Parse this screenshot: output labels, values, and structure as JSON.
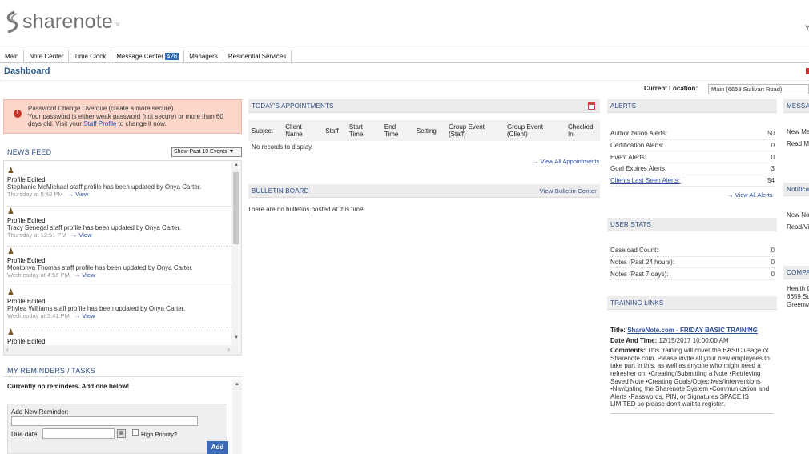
{
  "header": {
    "logo_text": "sharenote",
    "logo_tm": "TM",
    "user_initial": "Y"
  },
  "nav": {
    "items": [
      {
        "label": "Main"
      },
      {
        "label": "Note Center"
      },
      {
        "label": "Time Clock"
      },
      {
        "label": "Message Center",
        "badge": "426"
      },
      {
        "label": "Managers"
      },
      {
        "label": "Residential Services"
      }
    ]
  },
  "page_title": "Dashboard",
  "location": {
    "label": "Current Location:",
    "value": "Main (6659 Sullivan Road)"
  },
  "password_alert": {
    "title": "Password Change Overdue (create a more secure)",
    "line1": "Your password is either weak password (not secure) or more than 60",
    "line2_prefix": "days old. Visit your ",
    "link": "Staff Profile",
    "line2_suffix": " to change it now."
  },
  "news_feed": {
    "heading": "NEWS FEED",
    "filter_value": "Show Past 10 Events",
    "items": [
      {
        "title": "Profile Edited",
        "message": "Stephanie McMichael staff profile has been updated by Onya Carter.",
        "when": "Thursday at 5:48 PM",
        "link": "View"
      },
      {
        "title": "Profile Edited",
        "message": "Tracy Senegal staff profile has been updated by Onya Carter.",
        "when": "Thursday at 12:51 PM",
        "link": "View"
      },
      {
        "title": "Profile Edited",
        "message": "Montonya Thomas staff profile has been updated by Onya Carter.",
        "when": "Wednesday at 4:56 PM",
        "link": "View"
      },
      {
        "title": "Profile Edited",
        "message": "Phylea Williams staff profile has been updated by Onya Carter.",
        "when": "Wednesday at 3:41 PM",
        "link": "View"
      },
      {
        "title": "Profile Edited",
        "message": "",
        "when": "",
        "link": ""
      }
    ]
  },
  "reminders": {
    "heading": "MY REMINDERS / TASKS",
    "empty_text": "Currently no reminders. Add one below!",
    "add_label": "Add New Reminder:",
    "due_label": "Due date:",
    "priority_label": "High Priority?",
    "add_button": "Add"
  },
  "appointments": {
    "heading": "TODAY'S APPOINTMENTS",
    "columns": [
      "Subject",
      "Client Name",
      "Staff",
      "Start Time",
      "End Time",
      "Setting",
      "Group Event (Staff)",
      "Group Event (Client)",
      "Checked-In"
    ],
    "empty_text": "No records to display.",
    "view_all": "View All Appointments"
  },
  "bulletin": {
    "heading": "BULLETIN BOARD",
    "view_link": "View Bulletin Center",
    "empty_text": "There are no bulletins posted at this time."
  },
  "alerts": {
    "heading": "ALERTS",
    "rows": [
      {
        "label": "Authorization Alerts:",
        "value": "50",
        "link": false
      },
      {
        "label": "Certification Alerts:",
        "value": "0",
        "link": false
      },
      {
        "label": "Event Alerts:",
        "value": "0",
        "link": false
      },
      {
        "label": "Goal Expires Alerts:",
        "value": "3",
        "link": false
      },
      {
        "label": "Clients Last Seen Alerts:",
        "value": "54",
        "link": true
      }
    ],
    "view_all": "View All Alerts"
  },
  "user_stats": {
    "heading": "USER STATS",
    "rows": [
      {
        "label": "Caseload Count:",
        "value": "0"
      },
      {
        "label": "Notes (Past 24 hours):",
        "value": "0"
      },
      {
        "label": "Notes (Past 7 days):",
        "value": "0"
      }
    ]
  },
  "training": {
    "heading": "TRAINING LINKS",
    "title_label": "Title:",
    "title_link": "ShareNote.com - FRIDAY BASIC TRAINING",
    "date_label": "Date And Time:",
    "date_value": "12/15/2017 10:00:00 AM",
    "comments_label": "Comments:",
    "comments_text": "This training will cover the BASIC usage of Sharenote.com. Please invite all your new employees to take part in this, as well as anyone who might need a refresher on: •Creating/Submitting a Note •Retrieving Saved Note •Creating Goals/Objectives/Interventions •Navigating the Sharenote System •Communication and Alerts •Passwords, PIN, or Signatures SPACE IS LIMITED so please don't wait to register."
  },
  "right_column": {
    "messages_head": "MESSA",
    "messages_lines": [
      "New Me",
      "Read M"
    ],
    "notif_head": "Notifica",
    "notif_lines": [
      "New No",
      "Read/Vi"
    ],
    "company_head": "COMPA",
    "company_lines": [
      "Health C",
      "6659 Su",
      "Greenw"
    ]
  }
}
